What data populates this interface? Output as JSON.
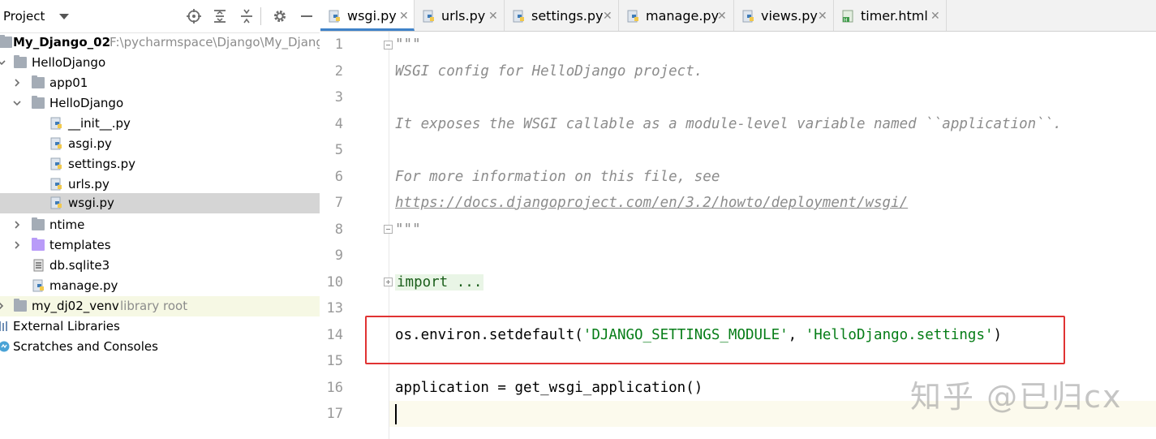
{
  "project_panel": {
    "title": "Project",
    "tree": [
      {
        "label": "My_Django_02",
        "extra": "F:\\pycharmspace\\Django\\My_Djang"
      },
      {
        "label": "HelloDjango"
      },
      {
        "label": "app01"
      },
      {
        "label": "HelloDjango"
      },
      {
        "label": "__init__.py"
      },
      {
        "label": "asgi.py"
      },
      {
        "label": "settings.py"
      },
      {
        "label": "urls.py"
      },
      {
        "label": "wsgi.py"
      },
      {
        "label": "ntime"
      },
      {
        "label": "templates"
      },
      {
        "label": "db.sqlite3"
      },
      {
        "label": "manage.py"
      },
      {
        "label": "my_dj02_venv",
        "extra": "library root"
      },
      {
        "label": "External Libraries"
      },
      {
        "label": "Scratches and Consoles"
      }
    ]
  },
  "tabs": [
    {
      "label": "wsgi.py"
    },
    {
      "label": "urls.py"
    },
    {
      "label": "settings.py"
    },
    {
      "label": "manage.py"
    },
    {
      "label": "views.py"
    },
    {
      "label": "timer.html"
    }
  ],
  "editor": {
    "line_numbers": [
      "1",
      "2",
      "3",
      "4",
      "5",
      "6",
      "7",
      "8",
      "9",
      "10",
      "13",
      "14",
      "15",
      "16",
      "17"
    ],
    "lines": {
      "l1": "\"\"\"",
      "l2": "WSGI config for HelloDjango project.",
      "l4": "It exposes the WSGI callable as a module-level variable named ``application``.",
      "l6": "For more information on this file, see",
      "l7": "https://docs.djangoproject.com/en/3.2/howto/deployment/wsgi/",
      "l8": "\"\"\"",
      "l10": "import ...",
      "l14_prefix": "os.environ.setdefault(",
      "l14_arg1": "'DJANGO_SETTINGS_MODULE'",
      "l14_sep": ", ",
      "l14_arg2": "'HelloDjango.settings'",
      "l14_suffix": ")",
      "l16": "application = get_wsgi_application()"
    }
  },
  "watermark": "知乎 @已归cx",
  "colors": {
    "accent": "#4083c9",
    "selection": "#d5d5d5",
    "highlight_box": "#e03333",
    "string": "#067d17",
    "docstring": "#8c8c8c"
  }
}
